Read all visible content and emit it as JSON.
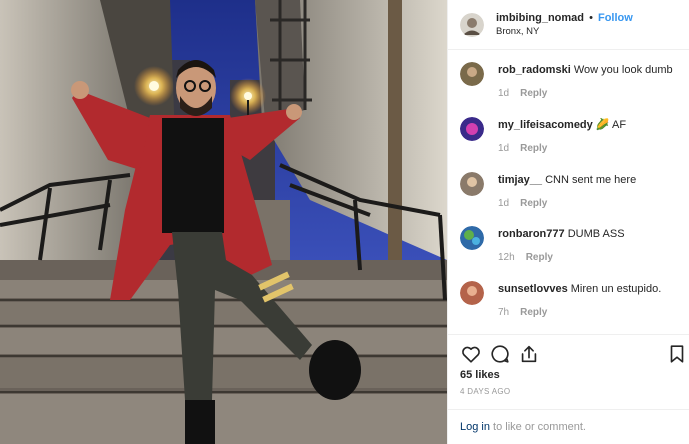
{
  "post": {
    "username": "imbibing_nomad",
    "separator": "•",
    "follow_label": "Follow",
    "location": "Bronx, NY"
  },
  "comments": [
    {
      "username": "rob_radomski",
      "text": "Wow you look dumb",
      "time": "1d",
      "reply_label": "Reply",
      "avatar_color": "#7a6a4a"
    },
    {
      "username": "my_lifeisacomedy",
      "text": "🌽 AF",
      "time": "1d",
      "reply_label": "Reply",
      "avatar_color": "#3a2a8a"
    },
    {
      "username": "timjay__",
      "text": "CNN sent me here",
      "time": "1d",
      "reply_label": "Reply",
      "avatar_color": "#8a7a6a"
    },
    {
      "username": "ronbaron777",
      "text": "DUMB ASS",
      "time": "12h",
      "reply_label": "Reply",
      "avatar_color": "#2f6aa8"
    },
    {
      "username": "sunsetlovves",
      "text": "Miren un estupido.",
      "time": "7h",
      "reply_label": "Reply",
      "avatar_color": "#b4634a"
    }
  ],
  "actions": {
    "icons": [
      "heart-icon",
      "comment-icon",
      "share-icon",
      "bookmark-icon"
    ],
    "likes": "65 likes",
    "timestamp": "4 DAYS AGO"
  },
  "login_bar": {
    "login_link": "Log in",
    "rest": " to like or comment."
  },
  "colors": {
    "link_blue": "#3897f0",
    "login_blue": "#003569",
    "muted": "#999999",
    "text": "#262626",
    "divider": "#efefef"
  }
}
